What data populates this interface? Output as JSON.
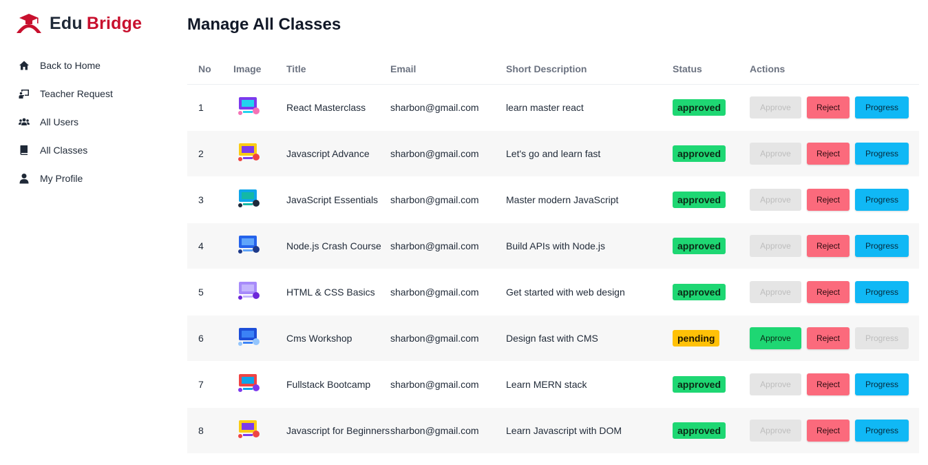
{
  "brand": {
    "part1": "Edu",
    "part2": "Bridge"
  },
  "nav": [
    {
      "label": "Back to Home",
      "icon": "home-icon"
    },
    {
      "label": "Teacher Request",
      "icon": "teacher-board-icon"
    },
    {
      "label": "All Users",
      "icon": "users-icon"
    },
    {
      "label": "All Classes",
      "icon": "book-icon"
    },
    {
      "label": "My Profile",
      "icon": "user-icon"
    }
  ],
  "page_title": "Manage All Classes",
  "table": {
    "headers": {
      "no": "No",
      "image": "Image",
      "title": "Title",
      "email": "Email",
      "desc": "Short Description",
      "status": "Status",
      "actions": "Actions"
    },
    "button_labels": {
      "approve": "Approve",
      "reject": "Reject",
      "progress": "Progress"
    },
    "rows": [
      {
        "no": "1",
        "title": "React Masterclass",
        "email": "sharbon@gmail.com",
        "desc": "learn master react",
        "status": "approved"
      },
      {
        "no": "2",
        "title": "Javascript Advance",
        "email": "sharbon@gmail.com",
        "desc": "Let's go and learn fast",
        "status": "approved"
      },
      {
        "no": "3",
        "title": "JavaScript Essentials",
        "email": "sharbon@gmail.com",
        "desc": "Master modern JavaScript",
        "status": "approved"
      },
      {
        "no": "4",
        "title": "Node.js Crash Course",
        "email": "sharbon@gmail.com",
        "desc": "Build APIs with Node.js",
        "status": "approved"
      },
      {
        "no": "5",
        "title": "HTML & CSS Basics",
        "email": "sharbon@gmail.com",
        "desc": "Get started with web design",
        "status": "approved"
      },
      {
        "no": "6",
        "title": "Cms Workshop",
        "email": "sharbon@gmail.com",
        "desc": "Design fast with CMS",
        "status": "pending"
      },
      {
        "no": "7",
        "title": "Fullstack Bootcamp",
        "email": "sharbon@gmail.com",
        "desc": "Learn MERN stack",
        "status": "approved"
      },
      {
        "no": "8",
        "title": "Javascript for Beginners",
        "email": "sharbon@gmail.com",
        "desc": "Learn Javascript with DOM",
        "status": "approved"
      }
    ]
  },
  "colors": {
    "brand_red": "#c8102e",
    "approved": "#1ed773",
    "pending": "#ffc107",
    "reject": "#fb6a7c",
    "progress": "#10b8f5",
    "disabled": "#e5e5e5"
  }
}
